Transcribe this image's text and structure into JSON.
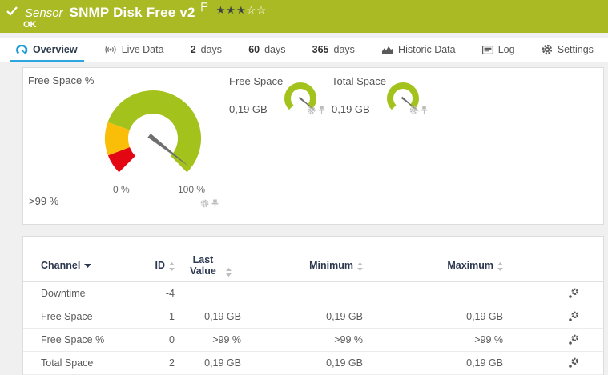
{
  "header": {
    "kind": "Sensor",
    "title": "SNMP Disk Free v2",
    "status": "OK",
    "bg_color": "#a9ba24",
    "priority": {
      "filled_stars": "★★★",
      "empty_stars": "☆☆",
      "filled": 3,
      "total": 5
    }
  },
  "tabs": [
    {
      "prefix": "",
      "label": "Overview",
      "active": true
    },
    {
      "prefix": "",
      "label": "Live Data"
    },
    {
      "prefix": "2",
      "label": "days"
    },
    {
      "prefix": "60",
      "label": "days"
    },
    {
      "prefix": "365",
      "label": "days"
    },
    {
      "prefix": "",
      "label": "Historic Data"
    },
    {
      "prefix": "",
      "label": "Log"
    },
    {
      "prefix": "",
      "label": "Settings"
    }
  ],
  "gauges": {
    "main": {
      "title": "Free Space %",
      "value_label": ">99 %",
      "value_fraction": 0.974,
      "scale_min_label": "0 %",
      "scale_max_label": "100 %",
      "needle_color": "#6e6e6e",
      "segments": [
        {
          "from": 0.0,
          "to": 0.09,
          "color": "#e30613"
        },
        {
          "from": 0.09,
          "to": 0.24,
          "color": "#fbbe08"
        },
        {
          "from": 0.24,
          "to": 1.0,
          "color": "#a3c21c"
        }
      ]
    },
    "mini": [
      {
        "title": "Free Space",
        "value_label": "0,19 GB",
        "value_fraction": 0.98,
        "needle_color": "#6e6e6e",
        "segments": [
          {
            "from": 0.0,
            "to": 1.0,
            "color": "#a3c21c"
          }
        ]
      },
      {
        "title": "Total Space",
        "value_label": "0,19 GB",
        "value_fraction": 0.98,
        "needle_color": "#6e6e6e",
        "segments": [
          {
            "from": 0.0,
            "to": 1.0,
            "color": "#a3c21c"
          }
        ]
      }
    ]
  },
  "table": {
    "headers": {
      "channel": "Channel",
      "id": "ID",
      "last": "Last Value",
      "min": "Minimum",
      "max": "Maximum"
    },
    "rows": [
      {
        "channel": "Downtime",
        "id": "-4",
        "last": "",
        "min": "",
        "max": ""
      },
      {
        "channel": "Free Space",
        "id": "1",
        "last": "0,19 GB",
        "min": "0,19 GB",
        "max": "0,19 GB"
      },
      {
        "channel": "Free Space %",
        "id": "0",
        "last": ">99 %",
        "min": ">99 %",
        "max": ">99 %"
      },
      {
        "channel": "Total Space",
        "id": "2",
        "last": "0,19 GB",
        "min": "0,19 GB",
        "max": "0,19 GB"
      }
    ]
  }
}
